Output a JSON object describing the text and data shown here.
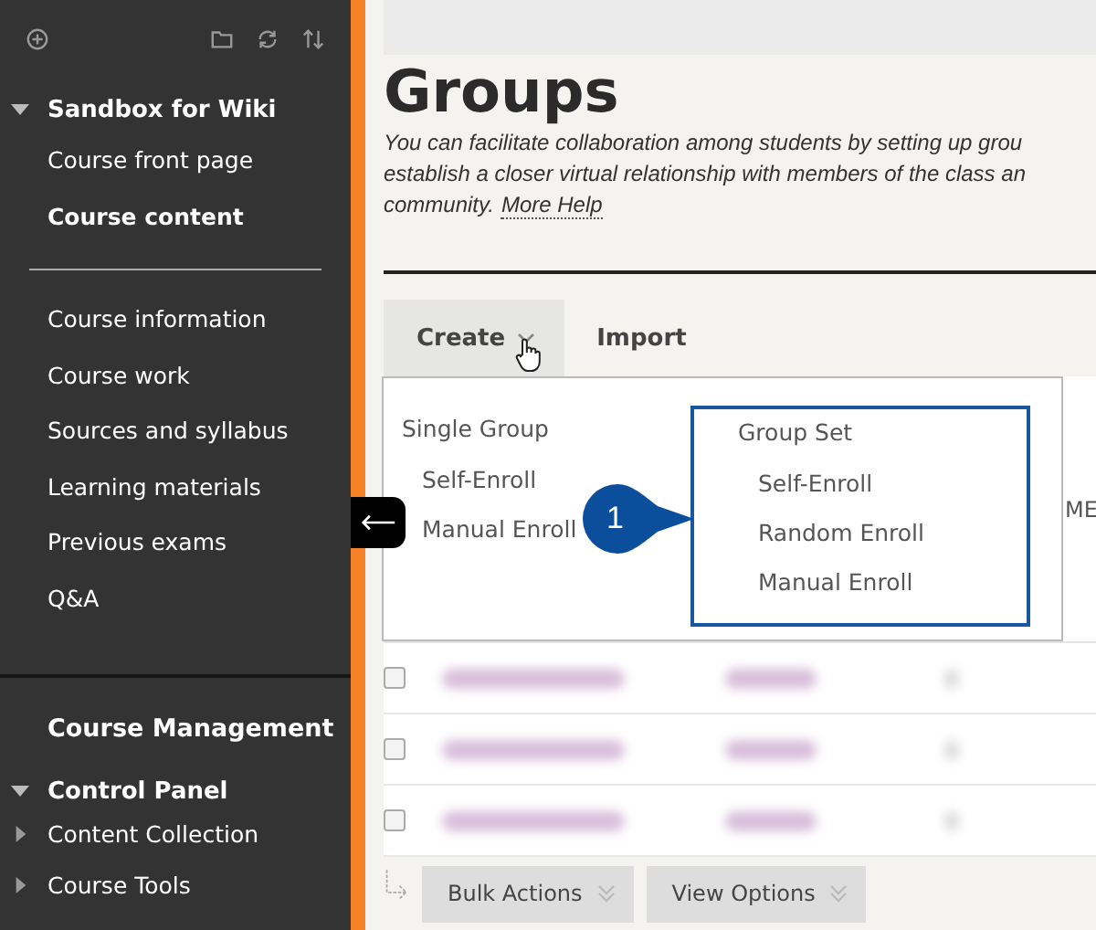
{
  "sidebar": {
    "course": {
      "title": "Sandbox for Wiki",
      "expanded": true,
      "items": [
        {
          "label": "Course front page",
          "selected": false
        },
        {
          "label": "Course content",
          "selected": true
        }
      ],
      "sections": [
        {
          "label": "Course information"
        },
        {
          "label": "Course work"
        },
        {
          "label": "Sources and syllabus"
        },
        {
          "label": "Learning materials"
        },
        {
          "label": "Previous exams"
        },
        {
          "label": "Q&A"
        }
      ]
    },
    "management": {
      "title": "Course Management"
    },
    "control_panel": {
      "label": "Control Panel",
      "expanded": true,
      "children": [
        {
          "label": "Content Collection",
          "expanded": false
        },
        {
          "label": "Course Tools",
          "expanded": false
        }
      ]
    }
  },
  "main": {
    "title": "Groups",
    "description": {
      "lines": [
        "You can facilitate collaboration among students by setting up grou",
        "establish a closer virtual relationship with members of the class an",
        "community."
      ],
      "link": "More Help"
    },
    "actions": [
      {
        "label": "Create",
        "kind": "menu",
        "selected": true
      },
      {
        "label": "Import",
        "kind": "plain",
        "selected": false
      }
    ],
    "dropdown": {
      "columns": [
        {
          "heading": "Single Group",
          "highlighted": false,
          "items": [
            "Self-Enroll",
            "Manual Enroll"
          ]
        },
        {
          "heading": "Group Set",
          "highlighted": true,
          "items": [
            "Self-Enroll",
            "Random Enroll",
            "Manual Enroll"
          ]
        }
      ],
      "callout": "1"
    },
    "column_header": "ME",
    "rows": [
      {
        "checked": false
      },
      {
        "checked": false
      },
      {
        "checked": false
      }
    ],
    "bottom_buttons": [
      "Bulk Actions",
      "View Options"
    ]
  }
}
